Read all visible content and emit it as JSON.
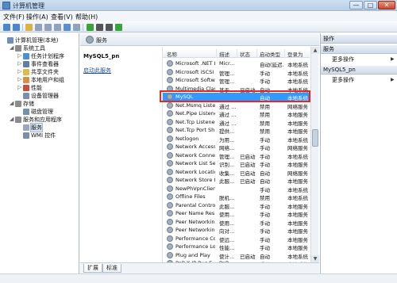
{
  "window": {
    "title": "计算机管理",
    "controls": [
      "—",
      "□",
      "✕"
    ]
  },
  "menu": [
    "文件(F)",
    "操作(A)",
    "查看(V)",
    "帮助(H)"
  ],
  "tree": [
    {
      "label": "计算机管理(本地)",
      "level": 0,
      "exp": "",
      "icon": "computer-icon",
      "color": "#6f8fb8"
    },
    {
      "label": "系统工具",
      "level": 1,
      "exp": "◢",
      "icon": "tools-icon",
      "color": "#8c8c8c"
    },
    {
      "label": "任务计划程序",
      "level": 2,
      "exp": "▷",
      "icon": "clock-icon",
      "color": "#4c8fd6"
    },
    {
      "label": "事件查看器",
      "level": 2,
      "exp": "▷",
      "icon": "event-viewer-icon",
      "color": "#5f7da8"
    },
    {
      "label": "共享文件夹",
      "level": 2,
      "exp": "▷",
      "icon": "shared-folder-icon",
      "color": "#e0b94d"
    },
    {
      "label": "本地用户和组",
      "level": 2,
      "exp": "▷",
      "icon": "users-icon",
      "color": "#d98e4a"
    },
    {
      "label": "性能",
      "level": 2,
      "exp": "▷",
      "icon": "performance-icon",
      "color": "#c94c3f"
    },
    {
      "label": "设备管理器",
      "level": 2,
      "exp": "",
      "icon": "device-manager-icon",
      "color": "#7b8fa6"
    },
    {
      "label": "存储",
      "level": 1,
      "exp": "◢",
      "icon": "storage-icon",
      "color": "#8c8c8c"
    },
    {
      "label": "磁盘管理",
      "level": 2,
      "exp": "",
      "icon": "disk-icon",
      "color": "#7b8fa6"
    },
    {
      "label": "服务和应用程序",
      "level": 1,
      "exp": "◢",
      "icon": "services-apps-icon",
      "color": "#8c8c8c"
    },
    {
      "label": "服务",
      "level": 2,
      "exp": "",
      "icon": "gear-icon",
      "color": "#9aa7b6",
      "selected": true
    },
    {
      "label": "WMI 控件",
      "level": 2,
      "exp": "",
      "icon": "wmi-icon",
      "color": "#7b8fa6"
    }
  ],
  "center": {
    "header": "服务",
    "detail_name": "MySQL5_pn",
    "detail_link": "启动此服务"
  },
  "columns": [
    "名称",
    "描述",
    "状态",
    "启动类型",
    "登录为"
  ],
  "services": [
    {
      "name": "Microsoft .NET F...",
      "desc": "Micr...",
      "status": "",
      "startup": "自动(延迟...",
      "logon": "本地系统"
    },
    {
      "name": "Microsoft iSCSI I...",
      "desc": "管理...",
      "status": "",
      "startup": "手动",
      "logon": "本地系统"
    },
    {
      "name": "Microsoft Softw...",
      "desc": "管理...",
      "status": "",
      "startup": "手动",
      "logon": "本地系统"
    },
    {
      "name": "Multimedia Clas...",
      "desc": "基于...",
      "status": "已启动",
      "startup": "自动",
      "logon": "本地系统"
    },
    {
      "name": "MySQL",
      "desc": "",
      "status": "",
      "startup": "自动",
      "logon": "本地系统",
      "selected": true
    },
    {
      "name": "Net.Msmq Liste...",
      "desc": "通过 ...",
      "status": "",
      "startup": "禁用",
      "logon": "网络服务"
    },
    {
      "name": "Net.Pipe Listene...",
      "desc": "通过 ...",
      "status": "",
      "startup": "禁用",
      "logon": "本地服务"
    },
    {
      "name": "Net.Tcp Listener...",
      "desc": "通过 ...",
      "status": "",
      "startup": "禁用",
      "logon": "本地服务"
    },
    {
      "name": "Net.Tcp Port Sh...",
      "desc": "提供...",
      "status": "",
      "startup": "禁用",
      "logon": "本地服务"
    },
    {
      "name": "Netlogon",
      "desc": "为用...",
      "status": "",
      "startup": "手动",
      "logon": "本地系统"
    },
    {
      "name": "Network Access ...",
      "desc": "网络...",
      "status": "",
      "startup": "手动",
      "logon": "网络服务"
    },
    {
      "name": "Network Connec...",
      "desc": "管理...",
      "status": "已启动",
      "startup": "手动",
      "logon": "本地系统"
    },
    {
      "name": "Network List Ser...",
      "desc": "识别...",
      "status": "已启动",
      "startup": "手动",
      "logon": "本地服务"
    },
    {
      "name": "Network Locatio...",
      "desc": "收集...",
      "status": "已启动",
      "startup": "自动",
      "logon": "网络服务"
    },
    {
      "name": "Network Store I...",
      "desc": "此服...",
      "status": "已启动",
      "startup": "自动",
      "logon": "本地服务"
    },
    {
      "name": "NewPhVpnClient...",
      "desc": "",
      "status": "",
      "startup": "手动",
      "logon": "本地系统"
    },
    {
      "name": "Offline Files",
      "desc": "脱机...",
      "status": "",
      "startup": "禁用",
      "logon": "本地系统"
    },
    {
      "name": "Parental Controls",
      "desc": "此服...",
      "status": "",
      "startup": "手动",
      "logon": "本地服务"
    },
    {
      "name": "Peer Name Res...",
      "desc": "使用...",
      "status": "",
      "startup": "手动",
      "logon": "本地服务"
    },
    {
      "name": "Peer Networkin...",
      "desc": "使用...",
      "status": "",
      "startup": "手动",
      "logon": "本地服务"
    },
    {
      "name": "Peer Networkin...",
      "desc": "向对...",
      "status": "",
      "startup": "手动",
      "logon": "本地服务"
    },
    {
      "name": "Performance Co...",
      "desc": "使远...",
      "status": "",
      "startup": "手动",
      "logon": "本地服务"
    },
    {
      "name": "Performance Lo...",
      "desc": "性能...",
      "status": "",
      "startup": "手动",
      "logon": "本地服务"
    },
    {
      "name": "Plug and Play",
      "desc": "使计...",
      "status": "已启动",
      "startup": "自动",
      "logon": "本地系统"
    },
    {
      "name": "PnP-X IP Bus E...",
      "desc": "PnP-...",
      "status": "",
      "startup": "手动",
      "logon": "本地系统"
    }
  ],
  "tabs": [
    "扩展",
    "标准"
  ],
  "actions": [
    {
      "type": "head",
      "label": "操作"
    },
    {
      "type": "head",
      "label": "服务"
    },
    {
      "type": "item",
      "label": "更多操作"
    },
    {
      "type": "head",
      "label": "MySQL5_pn"
    },
    {
      "type": "item",
      "label": "更多操作"
    }
  ],
  "colors": {
    "selection": "#3399ff",
    "highlight_border": "#e02a2a"
  }
}
